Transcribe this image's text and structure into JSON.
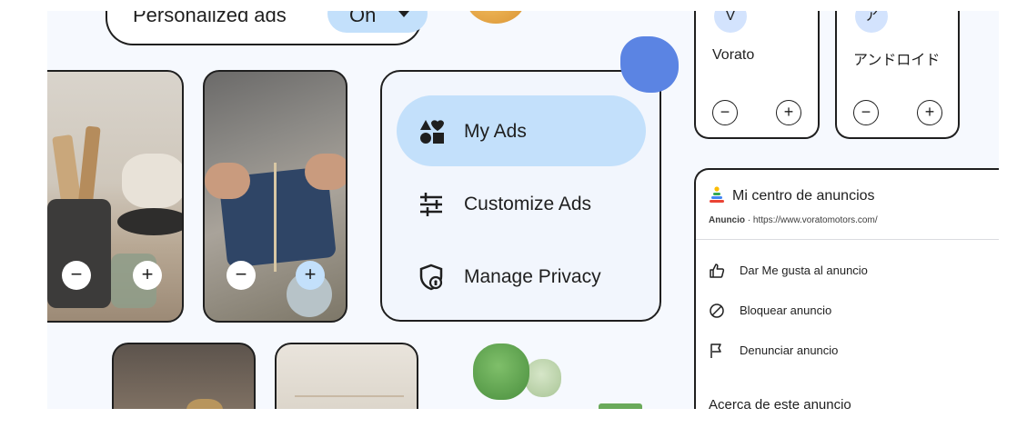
{
  "personalized": {
    "label": "Personalized ads",
    "status": "On",
    "status_color": "#c3e0fb"
  },
  "photos": [
    {
      "minus": "−",
      "plus": "+"
    },
    {
      "minus": "−",
      "plus": "+"
    }
  ],
  "menu": {
    "items": [
      {
        "label": "My Ads",
        "icon": "my-ads-shapes-icon",
        "active": true
      },
      {
        "label": "Customize Ads",
        "icon": "sliders-icon",
        "active": false
      },
      {
        "label": "Manage Privacy",
        "icon": "privacy-shield-icon",
        "active": false
      }
    ],
    "active_color": "#c3e0fb"
  },
  "advertisers": [
    {
      "initial": "V",
      "name": "Vorato",
      "minus": "−",
      "plus": "+"
    },
    {
      "initial": "ア",
      "name": "アンドロイド",
      "minus": "−",
      "plus": "+"
    }
  ],
  "ad_center": {
    "title": "Mi centro de anuncios",
    "sponsor_label": "Anuncio",
    "url": "https://www.voratomotors.com/",
    "actions": [
      {
        "label": "Dar Me gusta al anuncio",
        "icon": "thumbs-up-icon"
      },
      {
        "label": "Bloquear anuncio",
        "icon": "block-icon"
      },
      {
        "label": "Denunciar anuncio",
        "icon": "flag-icon"
      }
    ],
    "about": "Acerca de este anuncio"
  }
}
